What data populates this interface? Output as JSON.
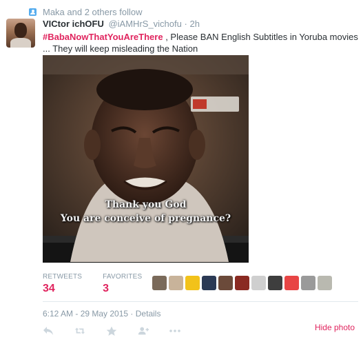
{
  "context": {
    "icon": "follow-icon",
    "text": "Maka and 2 others follow"
  },
  "tweet": {
    "fullname": "VICtor ichOFU",
    "username": "@iAMHrS_vichofu",
    "separator": "·",
    "time": "2h",
    "hashtag": "#BabaNowThatYouAreThere",
    "text_rest": " , Please BAN English Subtitles in Yoruba movies ... They will keep misleading the Nation"
  },
  "photo": {
    "caption_line1": "Thank you God",
    "caption_line2": "You are conceive of pregnance?"
  },
  "stats": {
    "retweets_label": "RETWEETS",
    "retweets_value": "34",
    "favorites_label": "FAVORITES",
    "favorites_value": "3"
  },
  "favoriters": [
    "#7a6a5a",
    "#c8b39a",
    "#f2c21a",
    "#2b3a55",
    "#6b4a3a",
    "#8a2a22",
    "#cfcfcf",
    "#3e3e3e",
    "#e84545",
    "#9a9a9a",
    "#b9b9b0"
  ],
  "footer": {
    "timestamp": "6:12 AM - 29 May 2015",
    "separator": "·",
    "details": "Details",
    "hide_photo": "Hide photo"
  },
  "actions": {
    "reply": "reply-icon",
    "retweet": "retweet-icon",
    "favorite": "star-icon",
    "follow": "follow-icon",
    "more": "more-icon"
  },
  "colors": {
    "accent": "#e0245e",
    "muted": "#8899a6",
    "text": "#292f33",
    "icon": "#ccd6dd",
    "follow_icon": "#55acee"
  }
}
